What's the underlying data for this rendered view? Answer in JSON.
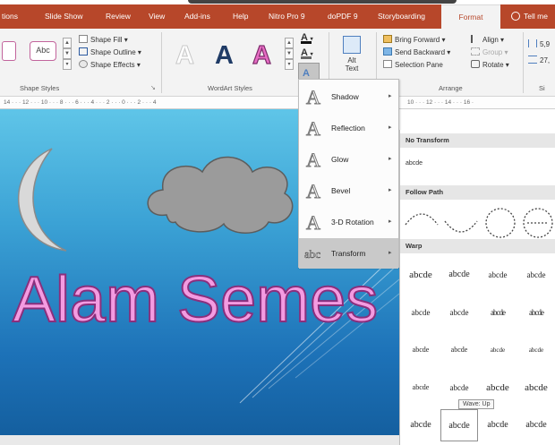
{
  "ribbon": {
    "tabs": [
      "tions",
      "Slide Show",
      "Review",
      "View",
      "Add-ins",
      "Help",
      "Nitro Pro 9",
      "doPDF 9",
      "Storyboarding",
      "Format",
      "Tell me"
    ],
    "active_tab": "Format",
    "shape_styles": {
      "abc_label": "Abc",
      "shape_fill": "Shape Fill",
      "shape_outline": "Shape Outline",
      "shape_effects": "Shape Effects",
      "group_label": "Shape Styles"
    },
    "wordart": {
      "sample_letter": "A",
      "text_glyph": "A",
      "group_label": "WordArt Styles"
    },
    "alt_text": {
      "line1": "Alt",
      "line2": "Text"
    },
    "arrange": {
      "bring_forward": "Bring Forward",
      "send_backward": "Send Backward",
      "selection_pane": "Selection Pane",
      "align": "Align",
      "group": "Group",
      "rotate": "Rotate",
      "group_label": "Arrange"
    },
    "size": {
      "height": "5,9",
      "width": "27,",
      "group_label": "Si"
    }
  },
  "ruler": {
    "text": "14 · · · 12 · · · 10 · · · 8 · · · 6 · · · 4 · · · 2 · · · 0 · · · 2 · · · 4",
    "right_text": "10 · · · 12 · · · 14 · · · 16 ·"
  },
  "slide": {
    "title_text": "Alam Semes"
  },
  "text_effects_menu": {
    "items": [
      {
        "glyph": "A",
        "label": "Shadow"
      },
      {
        "glyph": "A",
        "label": "Reflection"
      },
      {
        "glyph": "A",
        "label": "Glow"
      },
      {
        "glyph": "A",
        "label": "Bevel"
      },
      {
        "glyph": "A",
        "label": "3-D Rotation"
      },
      {
        "glyph": "abc",
        "label": "Transform"
      }
    ],
    "active_item": "Transform",
    "arrow": "▸"
  },
  "transform_gallery": {
    "no_transform_header": "No Transform",
    "no_transform_sample": "abcde",
    "follow_path_header": "Follow Path",
    "warp_header": "Warp",
    "warp_rows": [
      [
        "abcde",
        "abcde",
        "abcde",
        "abcde"
      ],
      [
        "abcde",
        "abcde",
        "abcde",
        "abcde"
      ],
      [
        "abcde",
        "abcde",
        "abcde",
        "abcde"
      ],
      [
        "abcde",
        "abcde",
        "abcde",
        "abcde"
      ],
      [
        "abcde",
        "abcde",
        "abcde",
        "abcde"
      ]
    ],
    "tooltip": "Wave: Up"
  },
  "colors": {
    "tab_bar": "#b7472a",
    "wordart_pink": "#f49be1",
    "slide_top": "#5fc5e8",
    "slide_bottom": "#145f9f"
  }
}
